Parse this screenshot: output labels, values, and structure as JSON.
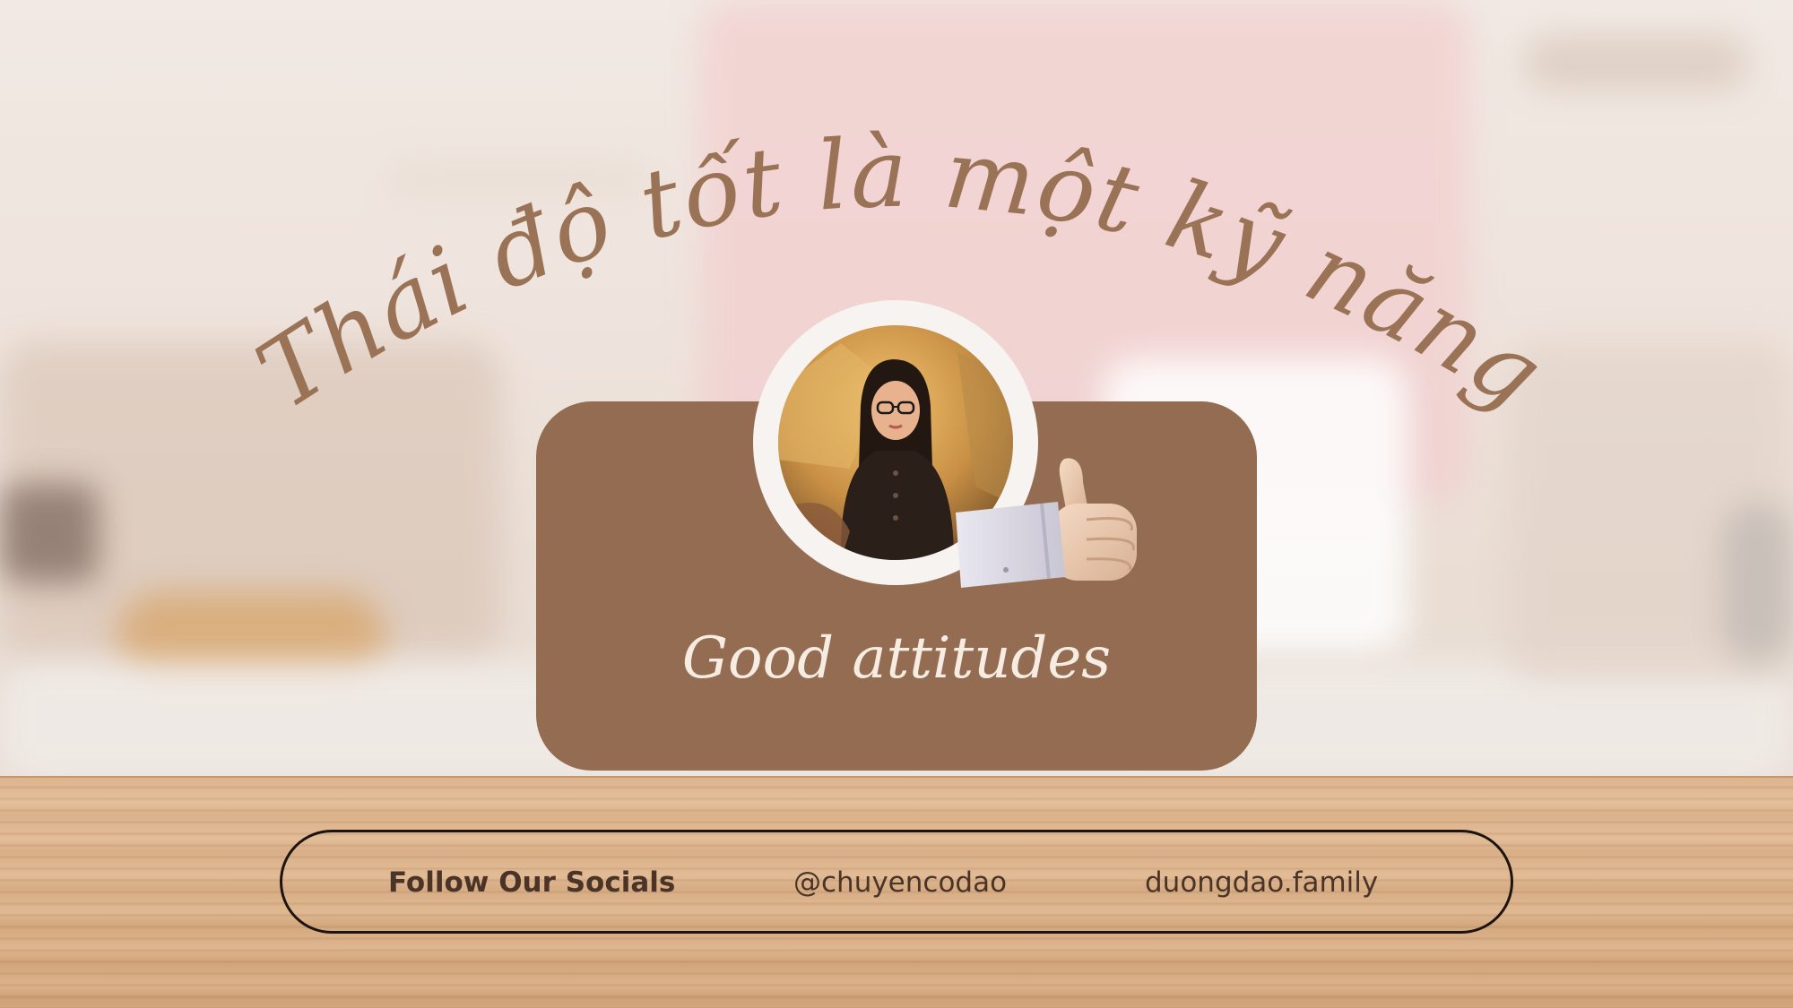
{
  "title": "Thái độ tốt là một kỹ năng",
  "card": {
    "caption": "Good attitudes"
  },
  "socials": {
    "label": "Follow Our Socials",
    "handle": "@chuyencodao",
    "site": "duongdao.family"
  },
  "colors": {
    "title": "#9a7357",
    "card": "#936c52",
    "caption": "#f6ece2",
    "socials_text": "#4a3428"
  },
  "icons": [
    "thumbs-up-icon"
  ]
}
